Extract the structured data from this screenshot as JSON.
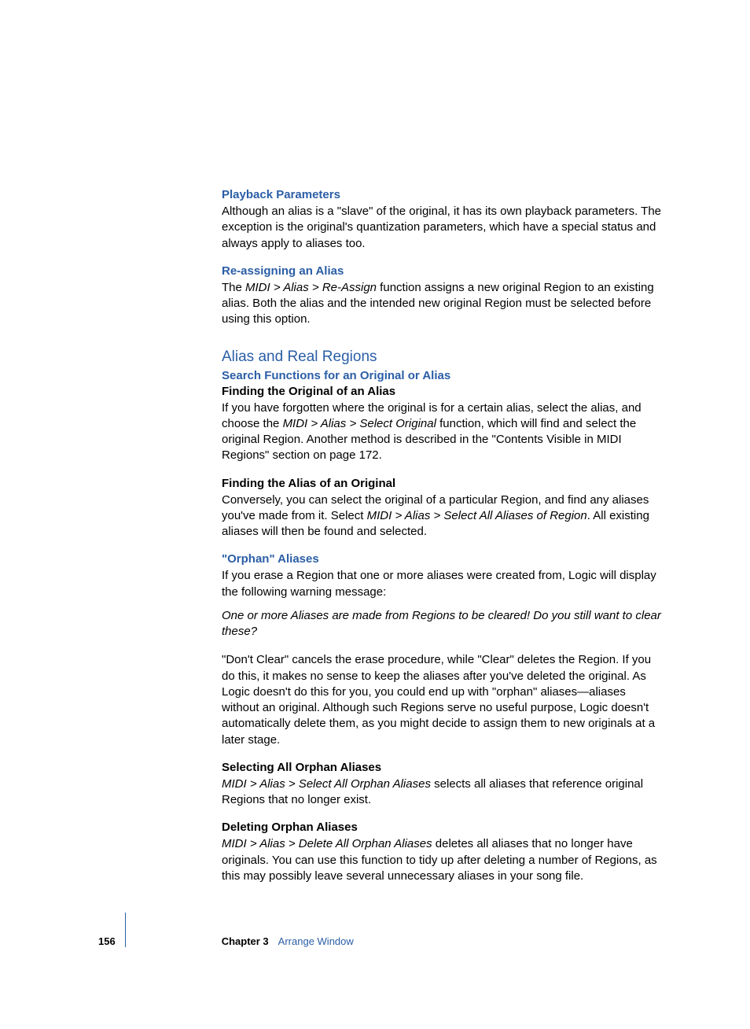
{
  "sections": {
    "playback": {
      "heading": "Playback Parameters",
      "body": "Although an alias is a \"slave\" of the original, it has its own playback parameters. The exception is the original's quantization parameters, which have a special status and always apply to aliases too."
    },
    "reassign": {
      "heading": "Re-assigning an Alias",
      "body_pre": "The ",
      "body_italic": "MIDI > Alias > Re-Assign",
      "body_post": " function assigns a new original Region to an existing alias. Both the alias and the intended new original Region must be selected before using this option."
    },
    "aliasreal": {
      "section_heading": "Alias and Real Regions",
      "sub_heading": "Search Functions for an Original or Alias",
      "finding_original": {
        "heading": "Finding the Original of an Alias",
        "body_pre": "If you have forgotten where the original is for a certain alias, select the alias, and choose the ",
        "body_italic": "MIDI > Alias > Select Original",
        "body_post": " function, which will find and select the original Region. Another method is described in the \"Contents Visible in MIDI Regions\" section on page 172."
      },
      "finding_alias": {
        "heading": "Finding the Alias of an Original",
        "body_pre": "Conversely, you can select the original of a particular Region, and find any aliases you've made from it. Select ",
        "body_italic": "MIDI > Alias > Select All Aliases of Region",
        "body_post": ". All existing aliases will then be found and selected."
      }
    },
    "orphan": {
      "heading": "\"Orphan\" Aliases",
      "body1": "If you erase a Region that one or more aliases were created from, Logic will display the following warning message:",
      "italic_body": "One or more Aliases are made from Regions to be cleared! Do you still want to clear these?",
      "body2": "\"Don't Clear\" cancels the erase procedure, while \"Clear\" deletes the Region. If you do this, it makes no sense to keep the aliases after you've deleted the original. As Logic doesn't do this for you, you could end up with \"orphan\" aliases—aliases without an original. Although such Regions serve no useful purpose, Logic doesn't automatically delete them, as you might decide to assign them to new originals at a later stage.",
      "selecting": {
        "heading": "Selecting All Orphan Aliases",
        "body_italic": "MIDI > Alias > Select All Orphan Aliases",
        "body_post": " selects all aliases that reference original Regions that no longer exist."
      },
      "deleting": {
        "heading": "Deleting Orphan Aliases",
        "body_italic": "MIDI > Alias > Delete All Orphan Aliases",
        "body_post": " deletes all aliases that no longer have originals. You can use this function to tidy up after deleting a number of Regions, as this may possibly leave several unnecessary aliases in your song file."
      }
    }
  },
  "footer": {
    "page": "156",
    "chapter_label": "Chapter 3",
    "chapter_title": "Arrange Window"
  }
}
